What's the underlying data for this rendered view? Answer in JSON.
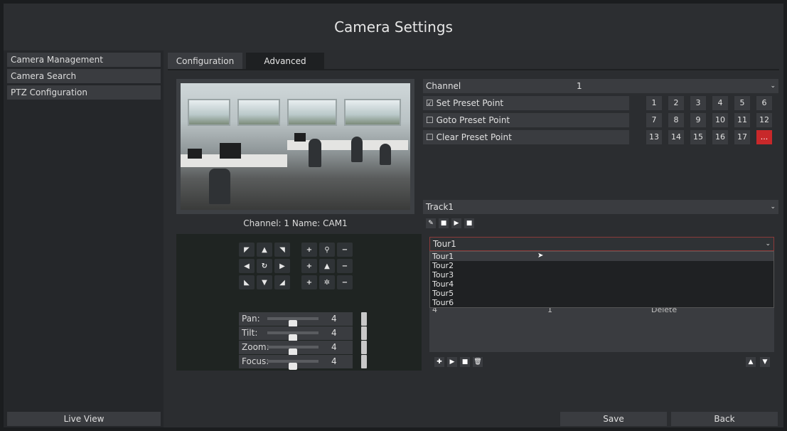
{
  "window": {
    "title": "Camera Settings"
  },
  "sidebar": {
    "items": [
      {
        "label": "Camera Management"
      },
      {
        "label": "Camera Search"
      },
      {
        "label": "PTZ Configuration"
      }
    ],
    "live_view": "Live View"
  },
  "tabs": [
    {
      "label": "Configuration",
      "active": false
    },
    {
      "label": "Advanced",
      "active": true
    }
  ],
  "preview": {
    "caption": "Channel: 1 Name: CAM1"
  },
  "ptz": {
    "sliders": [
      {
        "label": "Pan:",
        "value": "4",
        "level": 4
      },
      {
        "label": "Tilt:",
        "value": "4",
        "level": 4
      },
      {
        "label": "Zoom:",
        "value": "4",
        "level": 4
      },
      {
        "label": "Focus:",
        "value": "4",
        "level": 4
      }
    ]
  },
  "preset": {
    "channel_label": "Channel",
    "channel_value": "1",
    "set_label": "Set Preset Point",
    "set_checked": true,
    "goto_label": "Goto Preset Point",
    "goto_checked": false,
    "clear_label": "Clear Preset Point",
    "clear_checked": false,
    "numbers": [
      "1",
      "2",
      "3",
      "4",
      "5",
      "6",
      "7",
      "8",
      "9",
      "10",
      "11",
      "12",
      "13",
      "14",
      "15",
      "16",
      "17",
      "..."
    ],
    "active_color": "#c8282a"
  },
  "track": {
    "selected": "Track1"
  },
  "tour": {
    "selected": "Tour1",
    "options": [
      "Tour1",
      "Tour2",
      "Tour3",
      "Tour4",
      "Tour5",
      "Tour6"
    ],
    "row": {
      "col1": "4",
      "col2": "1",
      "col3": "Delete"
    }
  },
  "footer": {
    "save": "Save",
    "back": "Back"
  },
  "colors": {
    "background": "#2b2d30",
    "panel": "#3a3c40",
    "accent_red": "#c8282a"
  }
}
